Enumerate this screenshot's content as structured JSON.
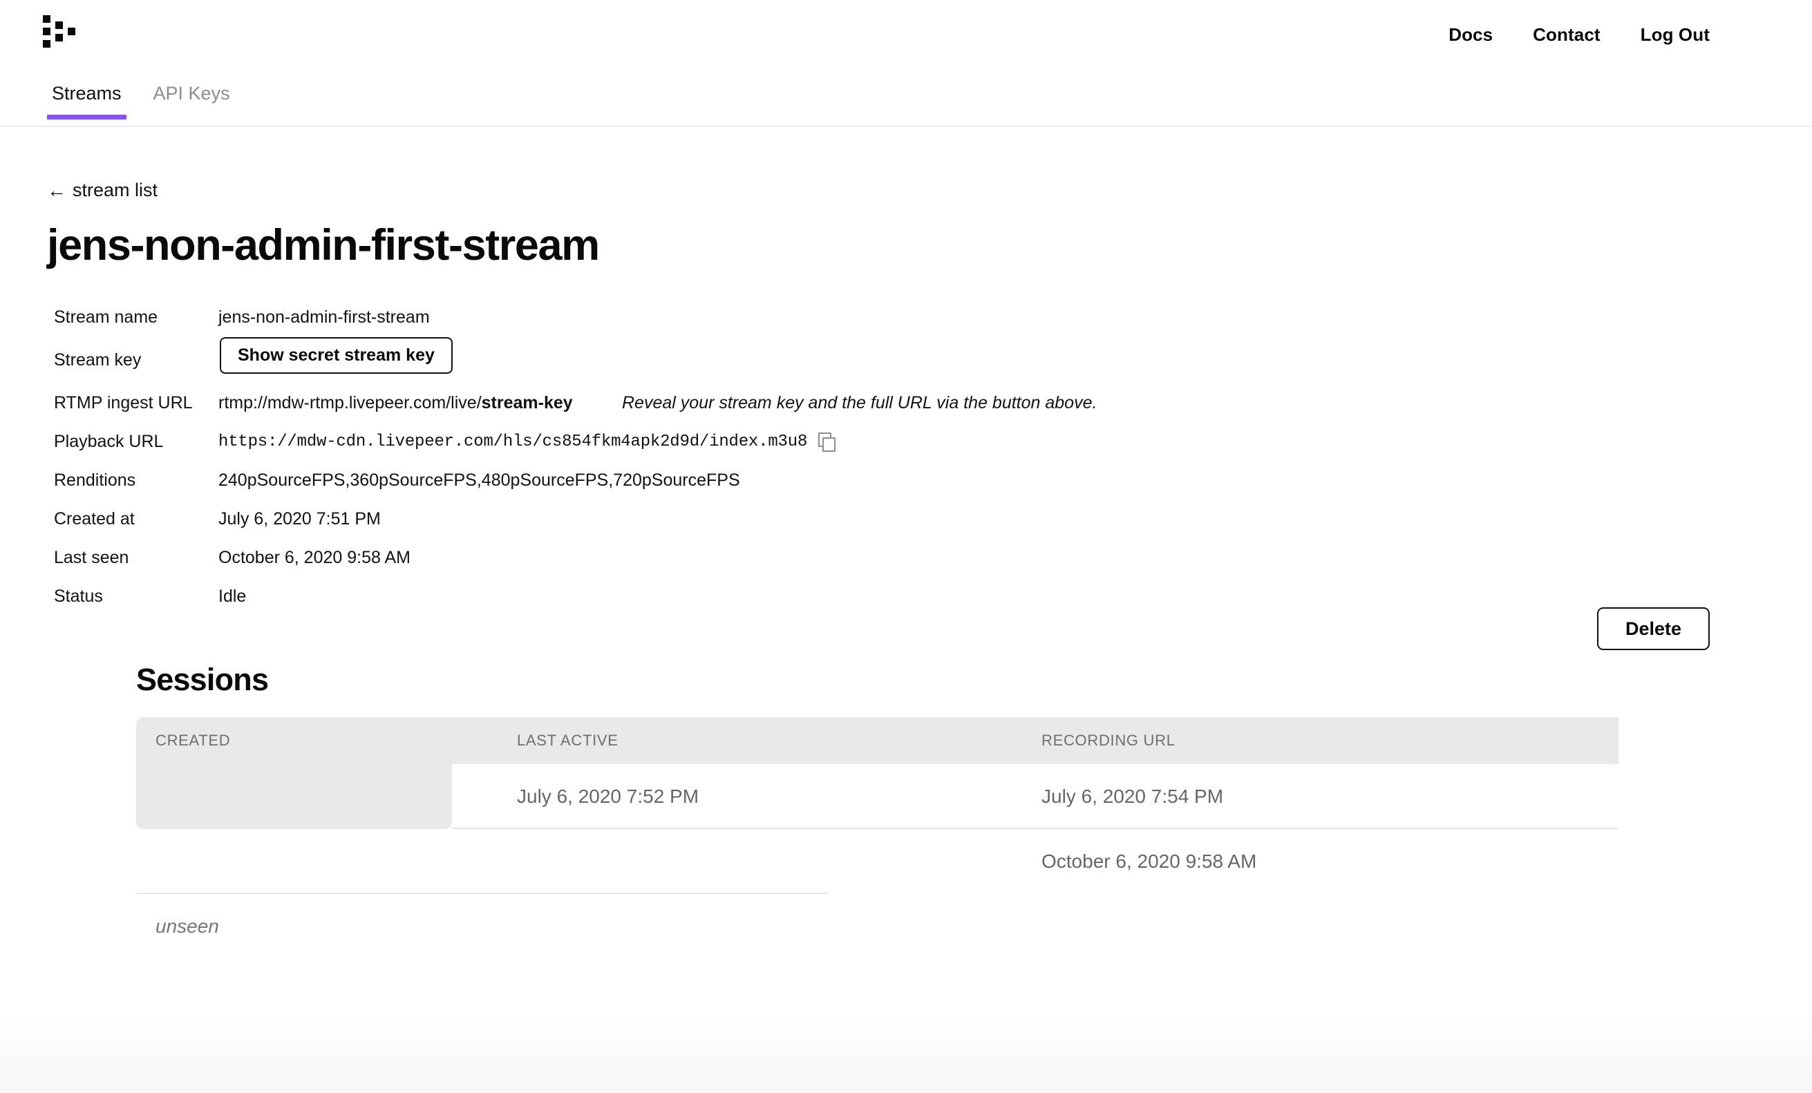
{
  "header": {
    "logo_name": "livepeer-logo",
    "nav": [
      {
        "label": "Docs"
      },
      {
        "label": "Contact"
      },
      {
        "label": "Log Out"
      }
    ]
  },
  "tabs": [
    {
      "label": "Streams",
      "active": true
    },
    {
      "label": "API Keys",
      "active": false
    }
  ],
  "breadcrumb": {
    "arrow": "←",
    "label": "stream list"
  },
  "page_title": "jens-non-admin-first-stream",
  "details": {
    "stream_name": {
      "label": "Stream name",
      "value": "jens-non-admin-first-stream"
    },
    "stream_key": {
      "label": "Stream key",
      "button_label": "Show secret stream key"
    },
    "rtmp_ingest_url": {
      "label": "RTMP ingest URL",
      "value_prefix": "rtmp://mdw-rtmp.livepeer.com/live/",
      "value_bold": "stream-key",
      "hint": "Reveal your stream key and the full URL via the button above."
    },
    "playback_url": {
      "label": "Playback URL",
      "value": "https://mdw-cdn.livepeer.com/hls/cs854fkm4apk2d9d/index.m3u8"
    },
    "renditions": {
      "label": "Renditions",
      "value": "240pSourceFPS,360pSourceFPS,480pSourceFPS,720pSourceFPS"
    },
    "created_at": {
      "label": "Created at",
      "value": "July 6, 2020 7:51 PM"
    },
    "last_seen": {
      "label": "Last seen",
      "value": "October 6, 2020 9:58 AM"
    },
    "status": {
      "label": "Status",
      "value": "Idle"
    }
  },
  "delete_button": {
    "label": "Delete"
  },
  "sessions": {
    "title": "Sessions",
    "columns": [
      "CREATED",
      "LAST ACTIVE",
      "RECORDING URL"
    ],
    "rows": [
      {
        "created": "",
        "last_active": "July 6, 2020 7:52 PM",
        "recording_url": "July 6, 2020 7:54 PM"
      },
      {
        "created": "",
        "last_active": "",
        "recording_url": "October 6, 2020 9:58 AM"
      },
      {
        "created": "unseen",
        "last_active": "",
        "recording_url": ""
      }
    ]
  },
  "colors": {
    "accent": "#8a4fff",
    "text": "#0a0a0a",
    "muted": "#8c8c8c",
    "table_header_bg": "#e9e9e9",
    "row_text": "#666666"
  }
}
